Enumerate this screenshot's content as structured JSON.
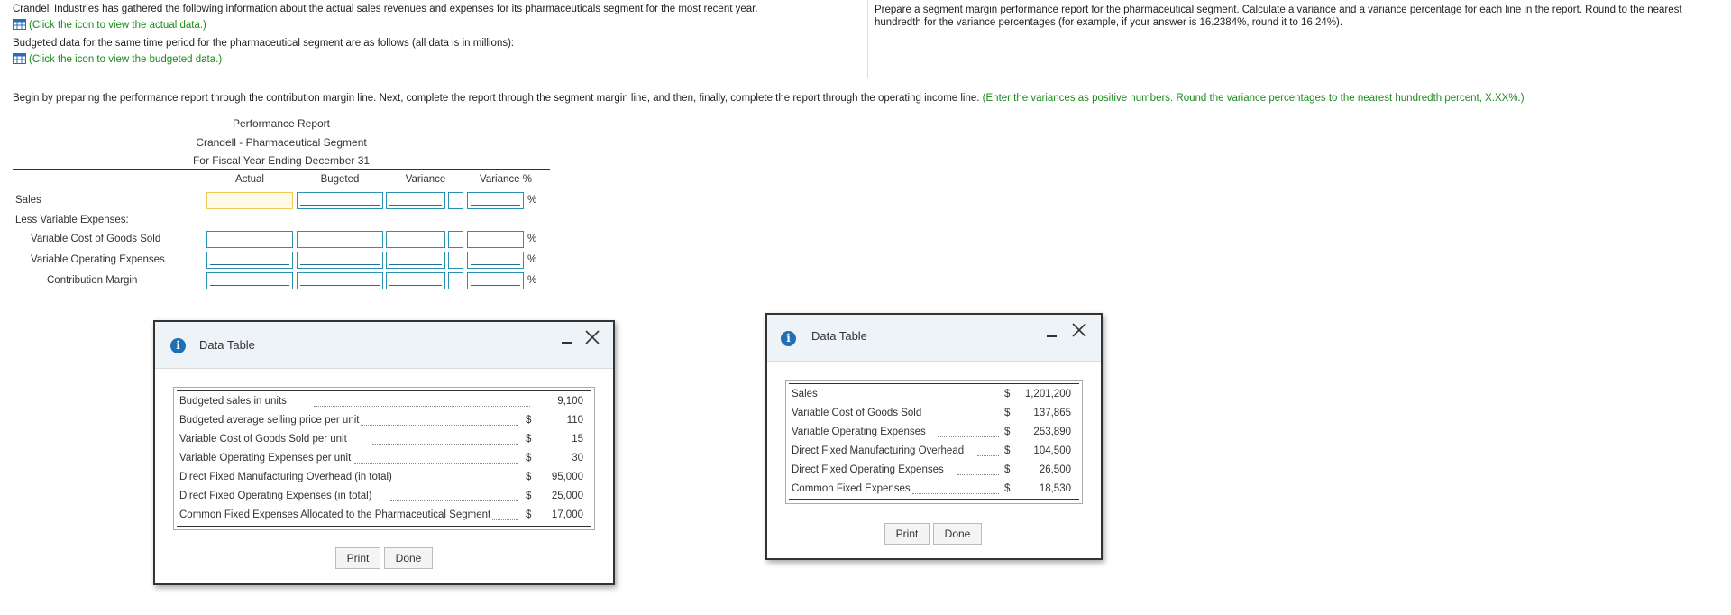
{
  "intro": {
    "line1": "Crandell Industries has gathered the following information about the actual sales revenues and expenses for its pharmaceuticals segment for the most recent year.",
    "link_actual": "(Click the icon to view the actual data.)",
    "line2": "Budgeted data for the same time period for the pharmaceutical segment are as follows (all data is in millions):",
    "link_budgeted": "(Click the icon to view the budgeted data.)"
  },
  "instructions": {
    "text": "Prepare a segment margin performance report for the pharmaceutical segment. Calculate a variance and a variance percentage for each line in the report. Round to the nearest hundredth for the variance percentages (for example, if your answer is 16.2384%, round it to 16.24%)."
  },
  "task": {
    "text": "Begin by preparing the performance report through the contribution margin line. Next, complete the report through the segment margin line, and then, finally, complete the report through the operating income line.",
    "hint": "(Enter the variances as positive numbers. Round the variance percentages to the nearest hundredth percent, X.XX%.)"
  },
  "report": {
    "title": "Performance Report",
    "company": "Crandell - Pharmaceutical Segment",
    "period": "For Fiscal Year Ending December 31",
    "columns": [
      "Actual",
      "Bugeted",
      "Variance",
      "Variance %"
    ],
    "rows": [
      {
        "label": "Sales",
        "has_inputs": true
      },
      {
        "label": "Less Variable Expenses:",
        "has_inputs": false
      },
      {
        "label": "Variable Cost of Goods Sold",
        "has_inputs": true
      },
      {
        "label": "Variable Operating Expenses",
        "has_inputs": true
      },
      {
        "label": "Contribution Margin",
        "has_inputs": true
      }
    ],
    "pct_symbol": "%"
  },
  "dialog_budgeted": {
    "title": "Data Table",
    "rows": [
      {
        "label": "Budgeted sales in units",
        "currency": "",
        "value": "9,100"
      },
      {
        "label": "Budgeted average selling price per unit",
        "currency": "$",
        "value": "110"
      },
      {
        "label": "Variable Cost of Goods Sold per unit",
        "currency": "$",
        "value": "15"
      },
      {
        "label": "Variable Operating Expenses per unit",
        "currency": "$",
        "value": "30"
      },
      {
        "label": "Direct Fixed Manufacturing Overhead (in total)",
        "currency": "$",
        "value": "95,000"
      },
      {
        "label": "Direct Fixed Operating Expenses (in total)",
        "currency": "$",
        "value": "25,000"
      },
      {
        "label": "Common Fixed Expenses Allocated to the Pharmaceutical Segment",
        "currency": "$",
        "value": "17,000"
      }
    ],
    "print_label": "Print",
    "done_label": "Done"
  },
  "dialog_actual": {
    "title": "Data Table",
    "rows": [
      {
        "label": "Sales",
        "currency": "$",
        "value": "1,201,200"
      },
      {
        "label": "Variable Cost of Goods Sold",
        "currency": "$",
        "value": "137,865"
      },
      {
        "label": "Variable Operating Expenses",
        "currency": "$",
        "value": "253,890"
      },
      {
        "label": "Direct Fixed Manufacturing Overhead",
        "currency": "$",
        "value": "104,500"
      },
      {
        "label": "Direct Fixed Operating Expenses",
        "currency": "$",
        "value": "26,500"
      },
      {
        "label": "Common Fixed Expenses",
        "currency": "$",
        "value": "18,530"
      }
    ],
    "print_label": "Print",
    "done_label": "Done"
  },
  "colors": {
    "link_green": "#1a8a1a",
    "input_border": "#2a8fb3",
    "active_input": "#f0c95a",
    "info_blue": "#1f6fb5"
  }
}
